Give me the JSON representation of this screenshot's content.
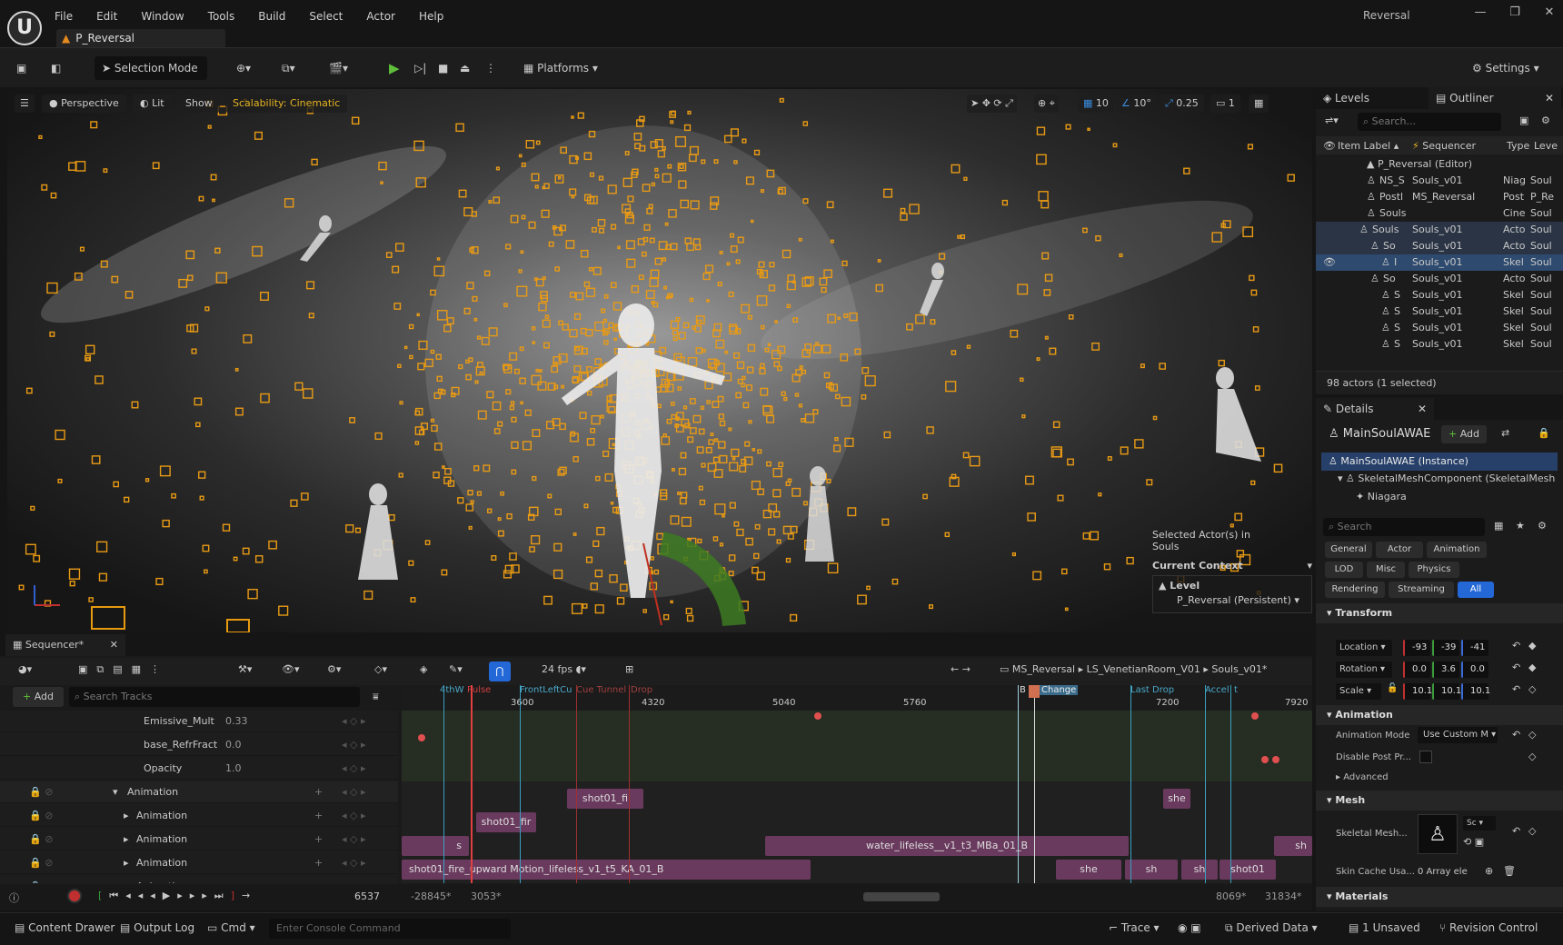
{
  "app": {
    "menu": [
      "File",
      "Edit",
      "Window",
      "Tools",
      "Build",
      "Select",
      "Actor",
      "Help"
    ],
    "doc_tab": "P_Reversal",
    "window_title": "Reversal"
  },
  "toolbar": {
    "mode": "Selection Mode",
    "platforms": "Platforms",
    "settings": "Settings"
  },
  "viewport": {
    "perspective": "Perspective",
    "lit": "Lit",
    "show": "Show",
    "scalability": "Scalability: Cinematic",
    "grid": "10",
    "angle": "10°",
    "scale": "0.25",
    "camspeed": "1",
    "selected_line1": "Selected Actor(s) in",
    "selected_line2": "Souls",
    "current_context": "Current Context",
    "level_label": "Level",
    "level_value": "P_Reversal (Persistent)"
  },
  "outliner": {
    "tab_levels": "Levels",
    "tab_outliner": "Outliner",
    "search_placeholder": "Search...",
    "col_item": "Item Label",
    "col_seq": "Sequencer",
    "col_type": "Type",
    "col_level": "Leve",
    "root": "P_Reversal (Editor)",
    "rows": [
      {
        "label": "NS_S",
        "seq": "Souls_v01",
        "type": "Niag",
        "level": "Soul"
      },
      {
        "label": "Postl",
        "seq": "MS_Reversal",
        "type": "Post",
        "level": "P_Re"
      },
      {
        "label": "Souls",
        "seq": "",
        "type": "Cine",
        "level": "Soul"
      },
      {
        "label": "Souls",
        "seq": "Souls_v01",
        "type": "Acto",
        "level": "Soul"
      },
      {
        "label": "So",
        "seq": "Souls_v01",
        "type": "Acto",
        "level": "Soul"
      },
      {
        "label": "I",
        "seq": "Souls_v01",
        "type": "Skel",
        "level": "Soul"
      },
      {
        "label": "So",
        "seq": "Souls_v01",
        "type": "Acto",
        "level": "Soul"
      },
      {
        "label": "S",
        "seq": "Souls_v01",
        "type": "Skel",
        "level": "Soul"
      },
      {
        "label": "S",
        "seq": "Souls_v01",
        "type": "Skel",
        "level": "Soul"
      },
      {
        "label": "S",
        "seq": "Souls_v01",
        "type": "Skel",
        "level": "Soul"
      },
      {
        "label": "S",
        "seq": "Souls_v01",
        "type": "Skel",
        "level": "Soul"
      }
    ],
    "count": "98 actors (1 selected)"
  },
  "details": {
    "tab": "Details",
    "actor": "MainSoulAWAE",
    "add": "Add",
    "instance": "MainSoulAWAE (Instance)",
    "component": "SkeletalMeshComponent (SkeletalMesh",
    "niagara": "Niagara",
    "search_placeholder": "Search",
    "filters": [
      "General",
      "Actor",
      "Animation",
      "LOD",
      "Misc",
      "Physics",
      "Rendering",
      "Streaming",
      "All"
    ],
    "transform": "Transform",
    "location": "Location",
    "loc_vals": [
      "-93",
      "-39",
      "-41"
    ],
    "rotation": "Rotation",
    "rot_vals": [
      "0.0",
      "3.6",
      "0.0"
    ],
    "scale": "Scale",
    "scale_vals": [
      "10.1",
      "10.1",
      "10.1"
    ],
    "animation": "Animation",
    "anim_mode": "Animation Mode",
    "anim_mode_val": "Use Custom M",
    "disable_post": "Disable Post Pr...",
    "advanced": "Advanced",
    "mesh": "Mesh",
    "skel_mesh": "Skeletal Mesh...",
    "skin_cache": "Skin Cache Usa...",
    "array": "0 Array ele",
    "materials": "Materials"
  },
  "sequencer": {
    "tab": "Sequencer*",
    "fps": "24 fps",
    "breadcrumbs": [
      "MS_Reversal",
      "LS_VenetianRoom_V01",
      "Souls_v01*"
    ],
    "add": "Add",
    "search_placeholder": "Search Tracks",
    "tracks": [
      {
        "name": "Emissive_Mult",
        "value": "0.33"
      },
      {
        "name": "base_RefrFract",
        "value": "0.0"
      },
      {
        "name": "Opacity",
        "value": "1.0"
      }
    ],
    "animation_group": "Animation",
    "anim_rows": [
      "Animation",
      "Animation",
      "Animation",
      "Animation"
    ],
    "ruler": [
      "3600",
      "4320",
      "5040",
      "5760",
      "7200",
      "7920"
    ],
    "markers": [
      "4thW",
      "Pulse",
      "FrontLeftCu",
      "Cue Tunnel",
      "Drop",
      "B",
      "Change",
      "Last Drop",
      "Accel",
      "t"
    ],
    "clips": [
      "shot01_fi",
      "shot01_fir",
      "s",
      "water_lifeless__v1_t3_MBa_01_B",
      "she",
      "shot01_fire_upward Motion_lifeless_v1_t5_KA_01_B",
      "she",
      "sh",
      "sh",
      "shot01",
      "sh"
    ],
    "current_frame": "6537",
    "range_start": "-28845*",
    "view_start": "3053*",
    "view_end": "8069*",
    "range_end": "31834*"
  },
  "statusbar": {
    "content_drawer": "Content Drawer",
    "output_log": "Output Log",
    "cmd": "Cmd",
    "console_placeholder": "Enter Console Command",
    "trace": "Trace",
    "derived": "Derived Data",
    "unsaved": "1 Unsaved",
    "revision": "Revision Control"
  }
}
